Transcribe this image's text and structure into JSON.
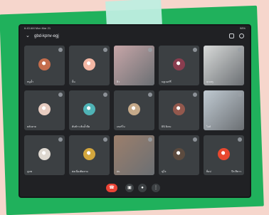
{
  "app": {
    "meeting_code": "gbd-kpnv-egj",
    "status_left": "6:43 AM Mon Mar 21",
    "status_right": "98%"
  },
  "colors": {
    "accent": "#ea4335",
    "background": "#202124",
    "tile": "#3c4043"
  },
  "participants": [
    {
      "name": "หนูน้ำ",
      "type": "avatar",
      "color": "#c46d4c"
    },
    {
      "name": "ปั้น",
      "type": "avatar",
      "color": "#f4b7a4"
    },
    {
      "name": "ดิว",
      "type": "video",
      "color": "#c7a6a8"
    },
    {
      "name": "บลูเบอร์รี่",
      "type": "avatar",
      "color": "#8a3d4f"
    },
    {
      "name": "คุณครู",
      "type": "video",
      "color": "#d8dad9"
    },
    {
      "name": "ตลับยาย",
      "type": "avatar",
      "color": "#e7ccc0"
    },
    {
      "name": "ต้นข้าว ต้นน้ำจืด",
      "type": "avatar",
      "color": "#4fb3b6"
    },
    {
      "name": "เตอร์โบ",
      "type": "avatar",
      "color": "#c5a989"
    },
    {
      "name": "มินิ ฮิเกม",
      "type": "avatar",
      "color": "#93584d"
    },
    {
      "name": "ไอส์",
      "type": "video",
      "color": "#c0cad2"
    },
    {
      "name": "ภูมพ",
      "type": "avatar",
      "color": "#ded8d0"
    },
    {
      "name": "ต่อเนื่องติดตาม",
      "type": "avatar",
      "color": "#d3a63d"
    },
    {
      "name": "ฝน",
      "type": "video",
      "color": "#9c7f6c"
    },
    {
      "name": "ฟูโจ",
      "type": "avatar",
      "color": "#5c4b3f"
    },
    {
      "name": "ท็อป",
      "type": "avatar",
      "color": "#e8482f",
      "extra": "ปีก สีขาว"
    }
  ],
  "controls": {
    "end_call": "end-call",
    "camera": "camera",
    "mic": "microphone",
    "more": "more"
  }
}
